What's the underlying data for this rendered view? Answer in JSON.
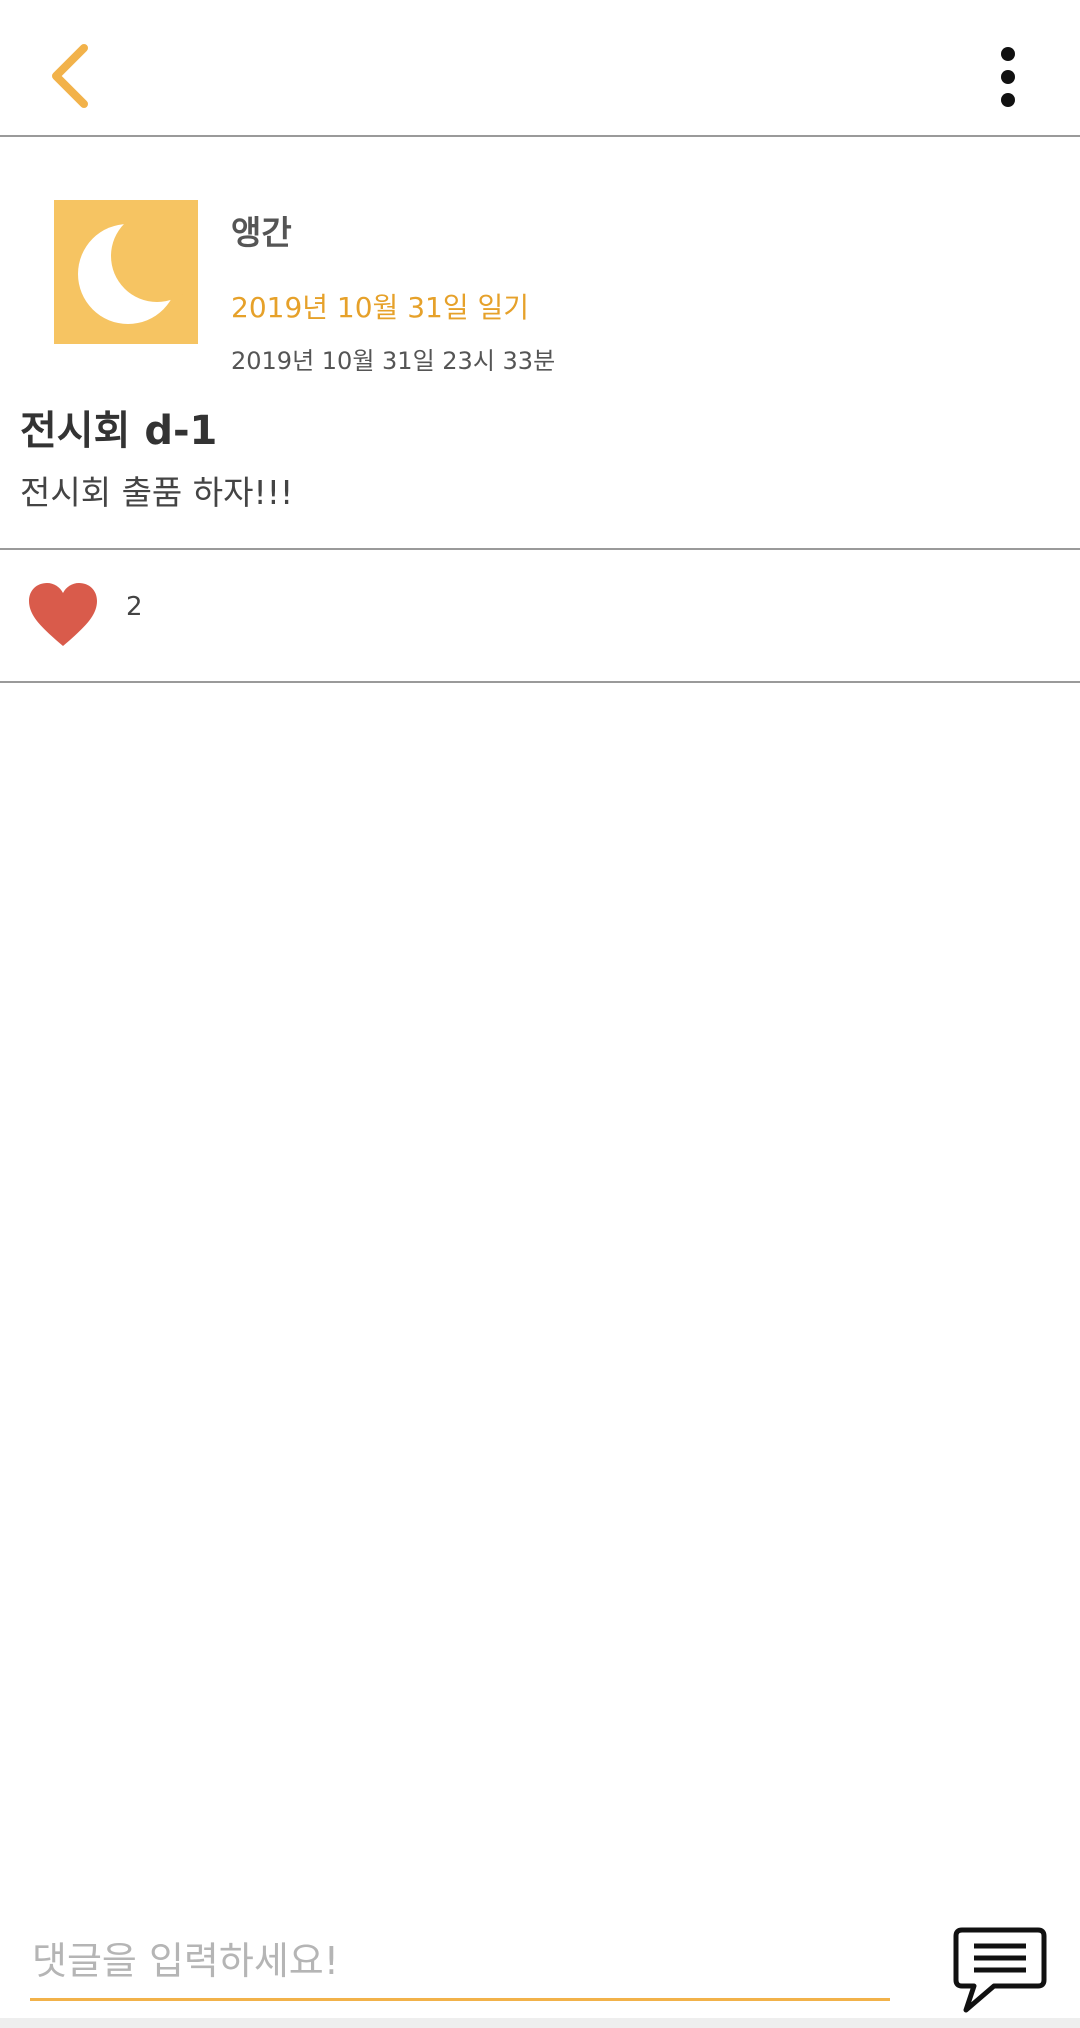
{
  "theme": {
    "accent": "#f2b24a",
    "accent_text": "#e6a12a",
    "heart": "#d95b4b",
    "divider": "#9a9a9a"
  },
  "topbar": {
    "back_icon": "chevron-left-icon",
    "menu_icon": "more-vertical-icon"
  },
  "post": {
    "avatar_icon": "moon-icon",
    "author": "앵간",
    "diary_date": "2019년 10월 31일 일기",
    "timestamp": "2019년 10월 31일 23시 33분",
    "title": "전시회 d-1",
    "body": "전시회 출품 하자!!!"
  },
  "likes": {
    "icon": "heart-icon",
    "count": "2"
  },
  "comment": {
    "placeholder": "댓글을 입력하세요!",
    "value": "",
    "send_icon": "comment-icon"
  }
}
